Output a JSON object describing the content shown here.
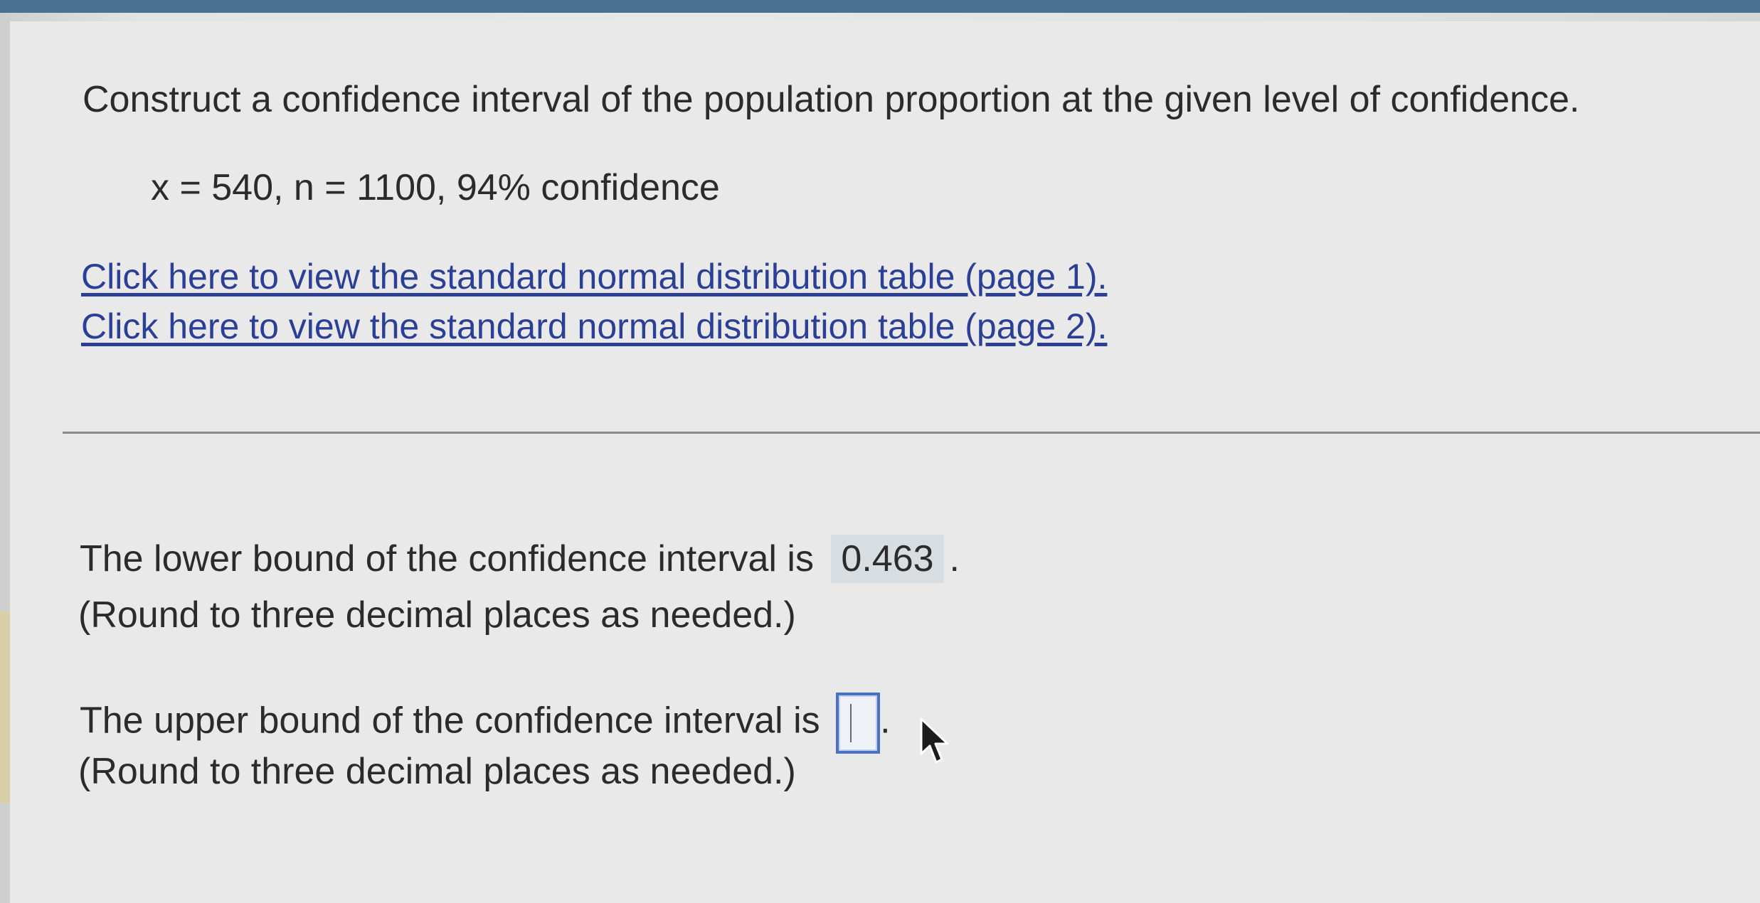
{
  "question": {
    "prompt": "Construct a confidence interval of the population proportion at the given level of confidence.",
    "given": "x = 540, n = 1100, 94% confidence"
  },
  "links": [
    {
      "label": "Click here to view the standard normal distribution table (page 1)."
    },
    {
      "label": "Click here to view the standard normal distribution table (page 2)."
    }
  ],
  "answers": {
    "lower": {
      "label": "The lower bound of the confidence interval is",
      "value": "0.463",
      "suffix": ".",
      "note": "(Round to three decimal places as needed.)"
    },
    "upper": {
      "label": "The upper bound of the confidence interval is",
      "value": "",
      "suffix": ".",
      "note": "(Round to three decimal places as needed.)"
    }
  },
  "icons": {
    "cursor": "mouse-pointer-icon"
  },
  "colors": {
    "top_bar": "#48728f",
    "link": "#2a3f95",
    "input_border": "#4a72c4",
    "answered_bg": "#d8dde2"
  }
}
